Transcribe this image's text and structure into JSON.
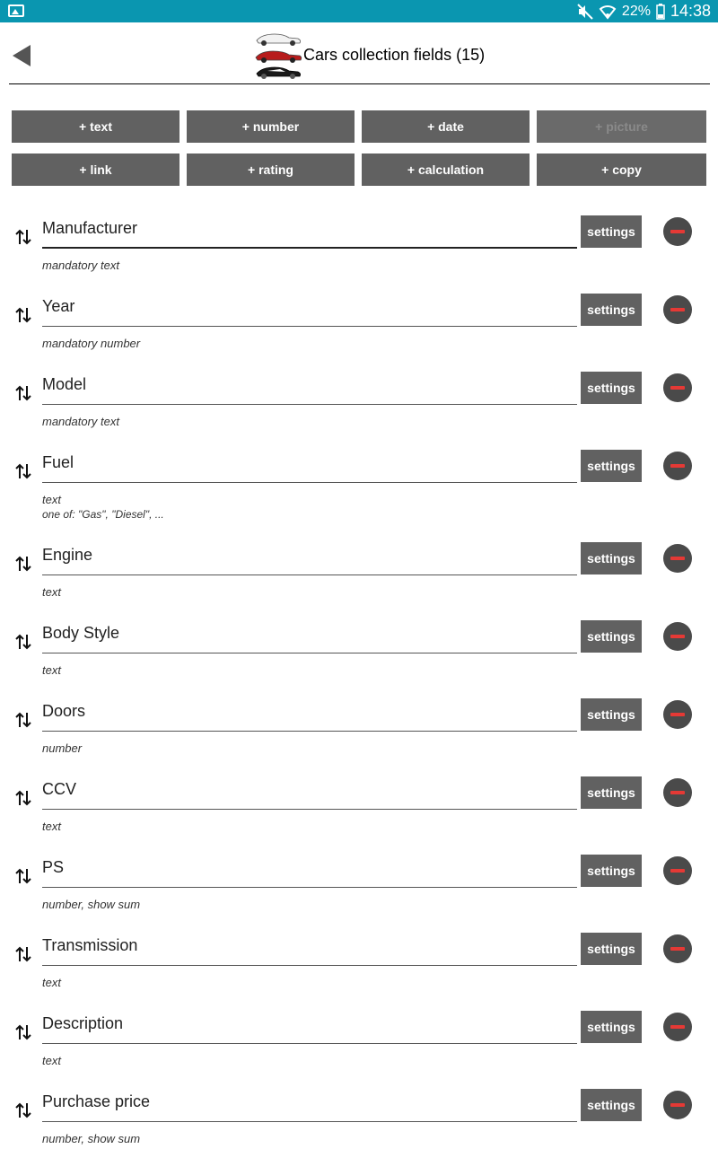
{
  "status_bar": {
    "battery": "22%",
    "time": "14:38",
    "icons": [
      "image-icon",
      "mute-icon",
      "wifi-icon",
      "battery-icon"
    ]
  },
  "header": {
    "title": "Cars collection fields (15)"
  },
  "add_buttons": [
    {
      "label": "+ text",
      "enabled": true
    },
    {
      "label": "+ number",
      "enabled": true
    },
    {
      "label": "+ date",
      "enabled": true
    },
    {
      "label": "+ picture",
      "enabled": false
    },
    {
      "label": "+ link",
      "enabled": true
    },
    {
      "label": "+ rating",
      "enabled": true
    },
    {
      "label": "+ calculation",
      "enabled": true
    },
    {
      "label": "+ copy",
      "enabled": true
    }
  ],
  "settings_label": "settings",
  "fields": [
    {
      "name": "Manufacturer",
      "desc1": "mandatory text",
      "desc2": ""
    },
    {
      "name": "Year",
      "desc1": "mandatory number",
      "desc2": ""
    },
    {
      "name": "Model",
      "desc1": "mandatory text",
      "desc2": ""
    },
    {
      "name": "Fuel",
      "desc1": "text",
      "desc2": "one of: \"Gas\", \"Diesel\", ..."
    },
    {
      "name": "Engine",
      "desc1": "text",
      "desc2": ""
    },
    {
      "name": "Body Style",
      "desc1": "text",
      "desc2": ""
    },
    {
      "name": "Doors",
      "desc1": "number",
      "desc2": ""
    },
    {
      "name": "CCV",
      "desc1": "text",
      "desc2": ""
    },
    {
      "name": "PS",
      "desc1": "number, show sum",
      "desc2": ""
    },
    {
      "name": "Transmission",
      "desc1": "text",
      "desc2": ""
    },
    {
      "name": "Description",
      "desc1": "text",
      "desc2": ""
    },
    {
      "name": "Purchase price",
      "desc1": "number, show sum",
      "desc2": ""
    }
  ]
}
